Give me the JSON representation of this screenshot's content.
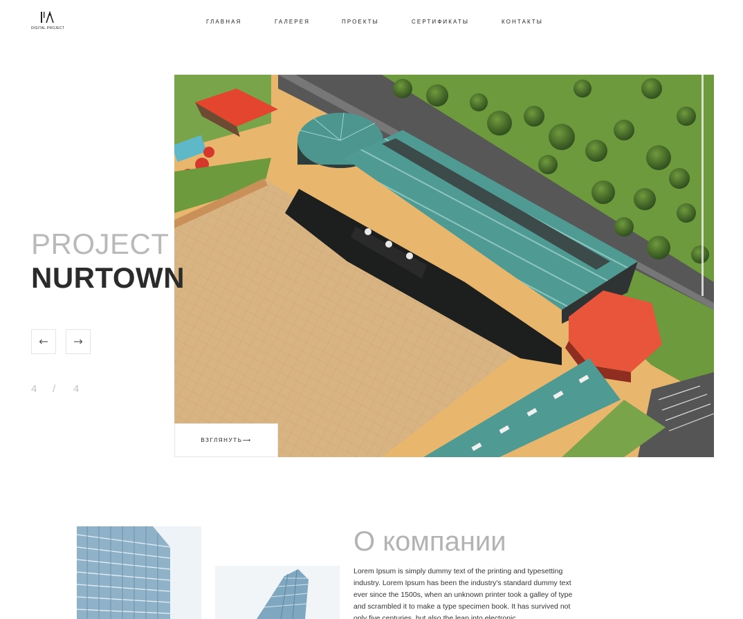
{
  "logo": {
    "text": "DIGITAL PROJECT",
    "icon": "logo-mark"
  },
  "nav": {
    "items": [
      {
        "label": "ГЛАВНАЯ"
      },
      {
        "label": "ГАЛЕРЕЯ"
      },
      {
        "label": "ПРОЕКТЫ"
      },
      {
        "label": "СЕРТИФИКАТЫ"
      },
      {
        "label": "КОНТАКТЫ"
      }
    ]
  },
  "hero": {
    "title_line1": "PROJECT",
    "title_line2": "NURTOWN",
    "prev_icon": "arrow-left-icon",
    "next_icon": "arrow-right-icon",
    "current_slide": "4",
    "separator": "/",
    "total_slides": "4",
    "view_button": "ВЗГЛЯНУТЬ⟶",
    "image": "aerial-render-sports-complex"
  },
  "about": {
    "title": "О компании",
    "text": "Lorem Ipsum is simply dummy text of the printing and typesetting industry. Lorem Ipsum has been the industry's standard dummy text ever since the 1500s, when an unknown printer took a galley of type and scrambled it to make a type specimen book. It has survived not only five centuries, but also the leap into electronic"
  },
  "colors": {
    "accent_grey": "#b9b9b9",
    "dark": "#2b2b2b",
    "roof_teal": "#4d9a92",
    "roof_red": "#e0533a"
  }
}
